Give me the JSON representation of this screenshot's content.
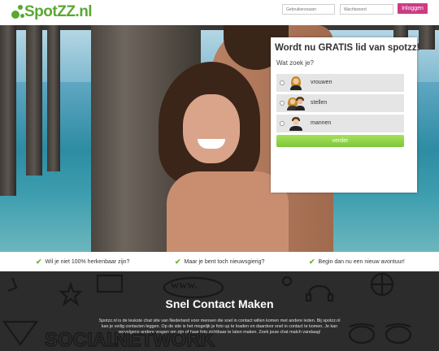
{
  "header": {
    "brand": "SpotZZ.nl",
    "username_placeholder": "Gebruikersnaam",
    "password_placeholder": "Wachtwoord",
    "login_label": "Inloggen"
  },
  "signup": {
    "title": "Wordt nu GRATIS lid van spotzz!",
    "question": "Wat zoek je?",
    "options": [
      {
        "label": "vrouwen",
        "icon": "woman-avatar-icon"
      },
      {
        "label": "stellen",
        "icon": "couple-avatar-icon"
      },
      {
        "label": "mannen",
        "icon": "man-avatar-icon"
      }
    ],
    "next_label": "verder"
  },
  "usps": [
    "Wil je niet 100% herkenbaar zijn?",
    "Maar je bent toch nieuwsgierig?",
    "Begin dan nu een nieuw avontuur!"
  ],
  "footer": {
    "title": "Snel Contact Maken",
    "text": "Spotzz.nl is de leukste chat site van Nederland voor mensen die snel in contact willen komen met andere leden. Bij spotzz.nl kan je veilig contacten leggen. Op de site is het mogelijk je foto up te loaden en daardoor snel in contact te komen. Je kan vervolgens andere vragen om zijn of haar foto zichtbaar te laten maken. Zoek jouw chat match vandaag!",
    "doodle_www": "www."
  },
  "colors": {
    "brand_green": "#5aa832",
    "login_pink": "#cc3b84",
    "cta_green": "#8fd14a",
    "dark_bg": "#2c2c2c"
  }
}
